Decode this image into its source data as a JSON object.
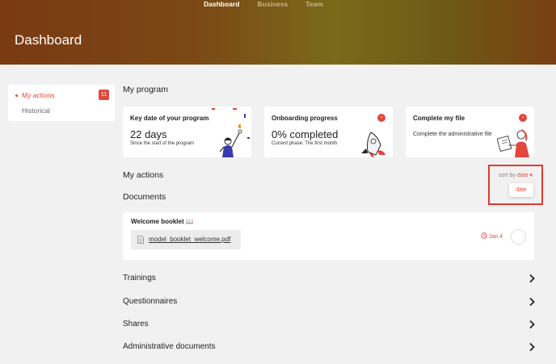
{
  "topnav": {
    "items": [
      "Dashboard",
      "Business",
      "Team"
    ]
  },
  "header": {
    "title": "Dashboard"
  },
  "sidebar": {
    "my_actions": "My actions",
    "my_actions_count": "11",
    "historical": "Historical"
  },
  "program": {
    "heading": "My program",
    "card1": {
      "title": "Key date of your program",
      "big": "22 days",
      "small": "Since the start of the program"
    },
    "card2": {
      "title": "Onboarding progress",
      "big": "0% completed",
      "small": "Current phase: The first month"
    },
    "card3": {
      "title": "Complete my file",
      "text": "Complete the administrative file"
    }
  },
  "actions": {
    "heading": "My actions",
    "sort_label": "sort by",
    "sort_value": "date",
    "sort_option": "date",
    "documents_heading": "Documents"
  },
  "document": {
    "title": "Welcome booklet",
    "title_icon": "📖",
    "file_name": "model_booklet_welcome.pdf",
    "date": "Jan 4"
  },
  "sections": [
    "Trainings",
    "Questionnaires",
    "Shares",
    "Administrative documents"
  ],
  "colors": {
    "accent": "#e2483c",
    "header_start": "#7a3a12",
    "header_mid": "#7a6a1a"
  },
  "icons": [
    "file-icon",
    "clock-icon",
    "chevron-right-icon",
    "chevron-down-icon",
    "arrow-right-icon"
  ]
}
